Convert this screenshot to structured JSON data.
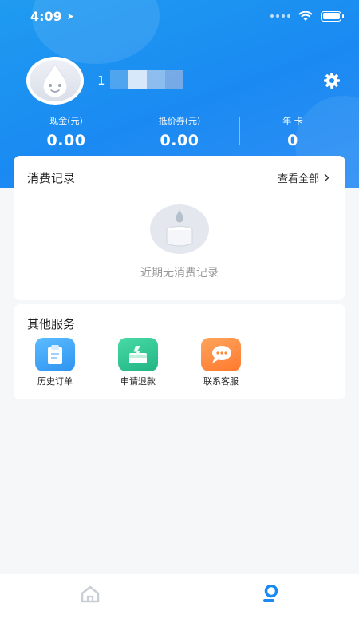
{
  "status_bar": {
    "time": "4:09"
  },
  "profile": {
    "user_id_prefix": "1"
  },
  "stats": [
    {
      "label": "现金(元)",
      "value": "0.00"
    },
    {
      "label": "抵价券(元)",
      "value": "0.00"
    },
    {
      "label": "年 卡",
      "value": "0"
    }
  ],
  "records": {
    "title": "消费记录",
    "view_all": "查看全部",
    "empty_text": "近期无消费记录"
  },
  "services": {
    "title": "其他服务",
    "items": [
      {
        "label": "历史订单",
        "icon": "clipboard-icon",
        "color": "#3ea8f5"
      },
      {
        "label": "申请退款",
        "icon": "refund-icon",
        "color": "#2ec28e"
      },
      {
        "label": "联系客服",
        "icon": "chat-bubble-icon",
        "color": "#ff8a3d"
      }
    ]
  },
  "tabbar": {
    "items": [
      {
        "icon": "home-icon"
      },
      {
        "icon": "profile-icon"
      }
    ]
  },
  "colors": {
    "brand_blue": "#1a8af2",
    "page_bg": "#f6f7f9"
  }
}
